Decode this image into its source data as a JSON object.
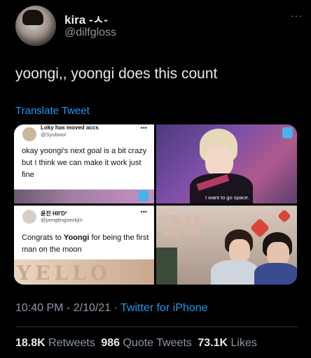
{
  "author": {
    "display_name": "kira -ㅅ-",
    "handle": "@dilfgloss"
  },
  "tweet": {
    "text": "yoongi,, yoongi does this count",
    "translate_label": "Translate Tweet"
  },
  "media": {
    "tweet_card_1": {
      "name": "Loky has moved accs",
      "handle": "@Syubwol",
      "more": "•••",
      "body": "okay yoongi's next goal is a bit crazy but I think we can make it work just fine"
    },
    "photo_2": {
      "subtitle": "I want to go space."
    },
    "tweet_card_3": {
      "name": "윤진 HII'D²",
      "handle": "@pengtingseokjin",
      "more": "•••",
      "body_before": "Congrats to ",
      "body_bold": "Yoongi",
      "body_after": " for being the first man on the moon",
      "balloons": "YELLO"
    },
    "photo_4": {
      "balloons": "20"
    }
  },
  "meta": {
    "time": "10:40 PM",
    "separator": "·",
    "date": "2/10/21",
    "source": "Twitter for iPhone"
  },
  "stats": {
    "retweets_count": "18.8K",
    "retweets_label": "Retweets",
    "quotes_count": "986",
    "quotes_label": "Quote Tweets",
    "likes_count": "73.1K",
    "likes_label": "Likes"
  },
  "header": {
    "more_label": "···"
  },
  "colors": {
    "background": "#000000",
    "link_blue": "#1d9bf0",
    "muted_text": "#8b98a5",
    "primary_text": "#e7e9ea"
  }
}
